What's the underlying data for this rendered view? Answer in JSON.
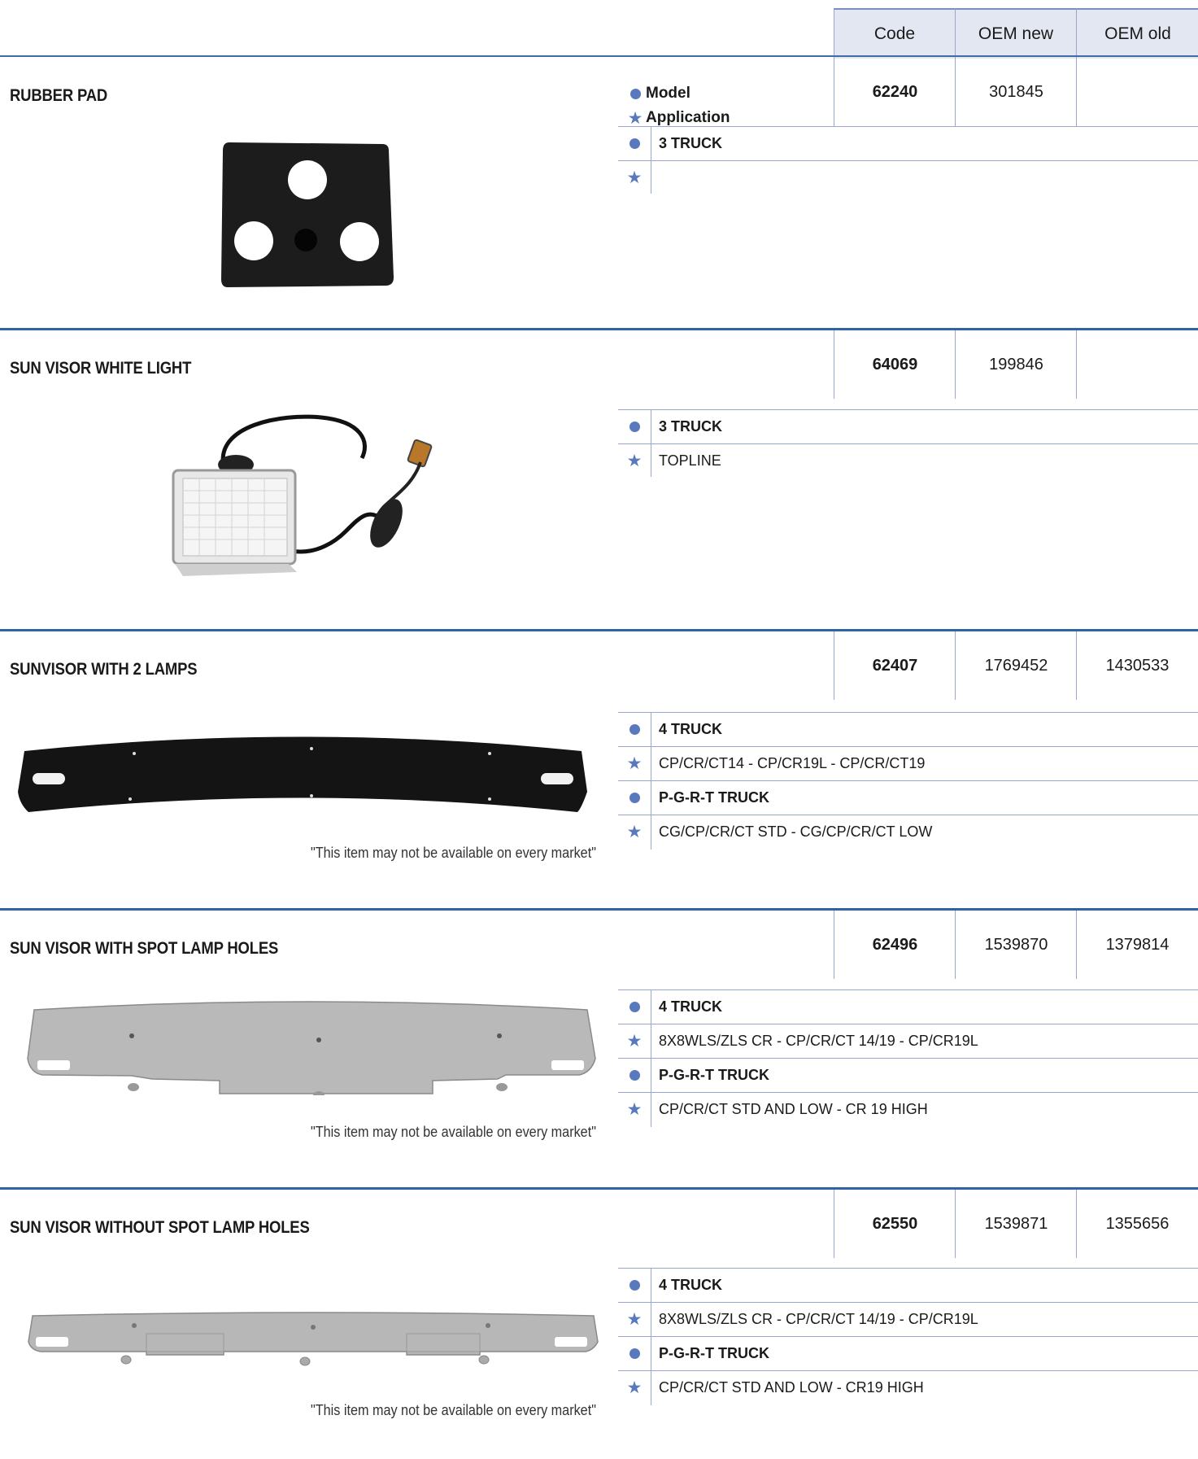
{
  "columns": {
    "code": "Code",
    "oem_new": "OEM new",
    "oem_old": "OEM old"
  },
  "legend": {
    "model": "Model",
    "application": "Application"
  },
  "products": [
    {
      "title": "RUBBER PAD",
      "code": "62240",
      "oem_new": "301845",
      "oem_old": "",
      "applications": [
        {
          "model": "3 TRUCK",
          "detail": ""
        }
      ],
      "note": ""
    },
    {
      "title": "SUN VISOR WHITE LIGHT",
      "code": "64069",
      "oem_new": "199846",
      "oem_old": "",
      "applications": [
        {
          "model": "3 TRUCK",
          "detail": "TOPLINE"
        }
      ],
      "note": ""
    },
    {
      "title": "SUNVISOR WITH 2 LAMPS",
      "code": "62407",
      "oem_new": "1769452",
      "oem_old": "1430533",
      "applications": [
        {
          "model": "4 TRUCK",
          "detail": "CP/CR/CT14 - CP/CR19L - CP/CR/CT19"
        },
        {
          "model": "P-G-R-T TRUCK",
          "detail": "CG/CP/CR/CT STD - CG/CP/CR/CT LOW"
        }
      ],
      "note": "\"This item may not be available on every market\""
    },
    {
      "title": "SUN VISOR WITH SPOT LAMP HOLES",
      "code": "62496",
      "oem_new": "1539870",
      "oem_old": "1379814",
      "applications": [
        {
          "model": "4 TRUCK",
          "detail": "8X8WLS/ZLS CR - CP/CR/CT 14/19 - CP/CR19L"
        },
        {
          "model": "P-G-R-T TRUCK",
          "detail": "CP/CR/CT STD AND LOW - CR 19 HIGH"
        }
      ],
      "note": "\"This item may not be available on every market\""
    },
    {
      "title": "SUN VISOR WITHOUT SPOT LAMP HOLES",
      "code": "62550",
      "oem_new": "1539871",
      "oem_old": "1355656",
      "applications": [
        {
          "model": "4 TRUCK",
          "detail": "8X8WLS/ZLS CR - CP/CR/CT 14/19 - CP/CR19L"
        },
        {
          "model": "P-G-R-T TRUCK",
          "detail": "CP/CR/CT STD AND LOW - CR19 HIGH"
        }
      ],
      "note": "\"This item may not be available on every market\""
    }
  ],
  "colors": {
    "accent": "#2f63a4",
    "symbol": "#5879bd",
    "header_bg": "#e3e7f1"
  },
  "icons": {
    "model": "dot-icon",
    "application": "star-icon"
  }
}
